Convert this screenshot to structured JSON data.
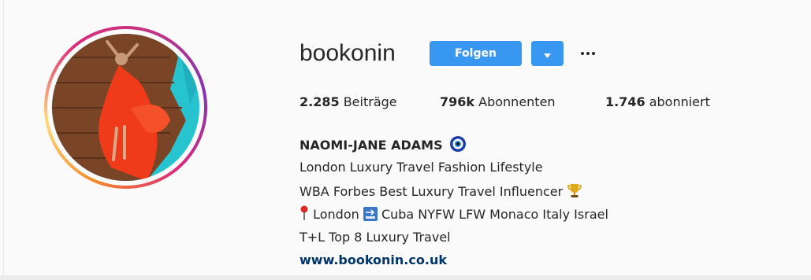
{
  "profile": {
    "username": "bookonin",
    "follow_label": "Folgen",
    "stats": {
      "posts_count": "2.285",
      "posts_label": "Beiträge",
      "followers_count": "796k",
      "followers_label": "Abonnenten",
      "following_count": "1.746",
      "following_label": "abonniert"
    },
    "full_name": "NAOMI-JANE ADAMS",
    "bio": {
      "line1": "London Luxury Travel Fashion Lifestyle",
      "line2": "WBA Forbes Best Luxury Travel Influencer",
      "line3_a": "London",
      "line3_b": "Cuba NYFW LFW Monaco Italy Israel",
      "line4": "T+L Top 8 Luxury Travel"
    },
    "website": "www.bookonin.co.uk"
  },
  "icons": {
    "name_emoji": "nazar-amulet-icon",
    "line2_emoji": "trophy-icon",
    "line3_pin": "round-pushpin-icon",
    "line3_soon": "soon-arrow-icon",
    "dropdown": "caret-down-icon",
    "more": "more-options-icon"
  },
  "colors": {
    "primary_button": "#3897f0",
    "link": "#003569",
    "text": "#262626",
    "background": "#fafafa"
  }
}
